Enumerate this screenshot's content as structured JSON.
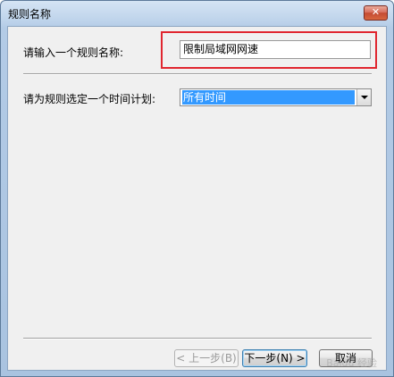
{
  "window": {
    "title": "规则名称",
    "close_label": "✕"
  },
  "form": {
    "name_label": "请输入一个规则名称:",
    "name_value": "限制局域网网速",
    "schedule_label": "请为规则选定一个时间计划:",
    "schedule_value": "所有时间"
  },
  "buttons": {
    "back": "< 上一步(B)",
    "next": "下一步(N) >",
    "cancel": "取消"
  },
  "watermark": "Baidu 经验",
  "colors": {
    "highlight_box": "#e0262f",
    "selected_option": "#3399ff"
  }
}
